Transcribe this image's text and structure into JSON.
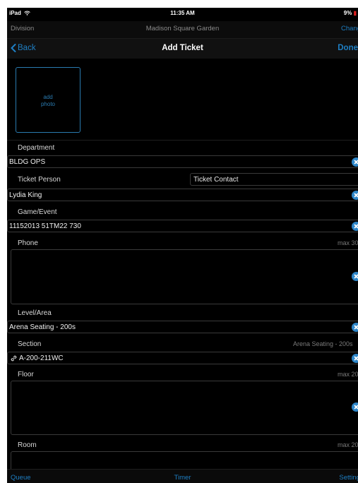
{
  "status_bar": {
    "device": "iPad",
    "wifi_icon": "wifi-icon",
    "time": "11:35 AM",
    "battery": "9%"
  },
  "division_bar": {
    "label": "Division",
    "value": "Madison Square Garden",
    "change": "Chang"
  },
  "nav": {
    "back": "Back",
    "title": "Add Ticket",
    "done": "Done"
  },
  "photo": {
    "label": "add\nphoto"
  },
  "form": {
    "department": {
      "label": "Department",
      "value": "BLDG OPS"
    },
    "ticket_person": {
      "label": "Ticket Person",
      "contact_button": "Ticket Contact",
      "value": "Lydia King"
    },
    "game_event": {
      "label": "Game/Event",
      "value": "11152013 51TM22 730"
    },
    "phone": {
      "label": "Phone",
      "hint": "max 30",
      "value": ""
    },
    "level_area": {
      "label": "Level/Area",
      "value": "Arena Seating - 200s"
    },
    "section": {
      "label": "Section",
      "hint": "Arena Seating - 200s",
      "value": "A-200-211WC"
    },
    "floor": {
      "label": "Floor",
      "hint": "max 20",
      "value": ""
    },
    "room": {
      "label": "Room",
      "hint": "max 20",
      "value": ""
    }
  },
  "tab_bar": {
    "queue": "Queue",
    "timer": "Timer",
    "settings": "Setting"
  },
  "colors": {
    "accent": "#1e7fc4",
    "background": "#000000",
    "battery_low": "#e02020"
  }
}
